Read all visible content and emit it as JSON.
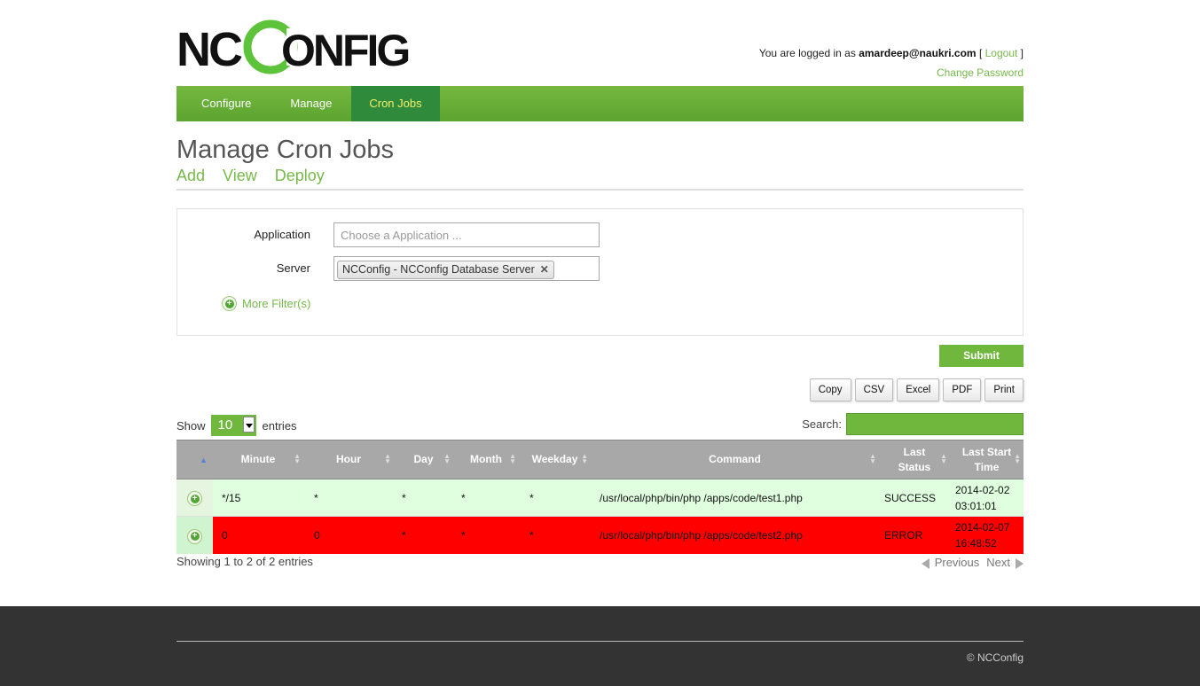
{
  "brand": {
    "logo_text": "NCCONFIG",
    "accent": "#6fb83d",
    "active_tab_bg": "#2f8a3b",
    "active_tab_text": "#f3f06a"
  },
  "user": {
    "prefix": "You are logged in as",
    "email": "amardeep@naukri.com",
    "logout": "Logout",
    "change_password": "Change Password"
  },
  "nav": {
    "items": [
      {
        "label": "Configure"
      },
      {
        "label": "Manage"
      },
      {
        "label": "Cron Jobs"
      }
    ],
    "active": "Cron Jobs"
  },
  "page": {
    "title": "Manage Cron Jobs",
    "subnav": [
      "Add",
      "View",
      "Deploy"
    ]
  },
  "filters": {
    "application_label": "Application",
    "application_placeholder": "Choose a Application ...",
    "server_label": "Server",
    "server_chip": "NCConfig - NCConfig Database Server",
    "more_filters": "More Filter(s)",
    "submit": "Submit"
  },
  "tools": [
    "Copy",
    "CSV",
    "Excel",
    "PDF",
    "Print"
  ],
  "table": {
    "show_label": "Show",
    "entries_label": "entries",
    "page_length": "10",
    "search_label": "Search:",
    "columns": {
      "minute": "Minute",
      "hour": "Hour",
      "day": "Day",
      "month": "Month",
      "weekday": "Weekday",
      "command": "Command",
      "last_status_1": "Last",
      "last_status_2": "Status",
      "last_start_1": "Last Start",
      "last_start_2": "Time"
    },
    "rows": [
      {
        "minute": "*/15",
        "hour": "*",
        "day": "*",
        "month": "*",
        "weekday": "*",
        "command": "/usr/local/php/bin/php /apps/code/test1.php",
        "status": "SUCCESS",
        "time_date": "2014-02-02",
        "time_clock": "03:01:01"
      },
      {
        "minute": "0",
        "hour": "0",
        "day": "*",
        "month": "*",
        "weekday": "*",
        "command": "/usr/local/php/bin/php /apps/code/test2.php",
        "status": "ERROR",
        "time_date": "2014-02-07",
        "time_clock": "16:48:52"
      }
    ],
    "info": "Showing 1 to 2 of 2 entries",
    "previous": "Previous",
    "next": "Next"
  },
  "footer": {
    "copyright": "© NCConfig"
  }
}
